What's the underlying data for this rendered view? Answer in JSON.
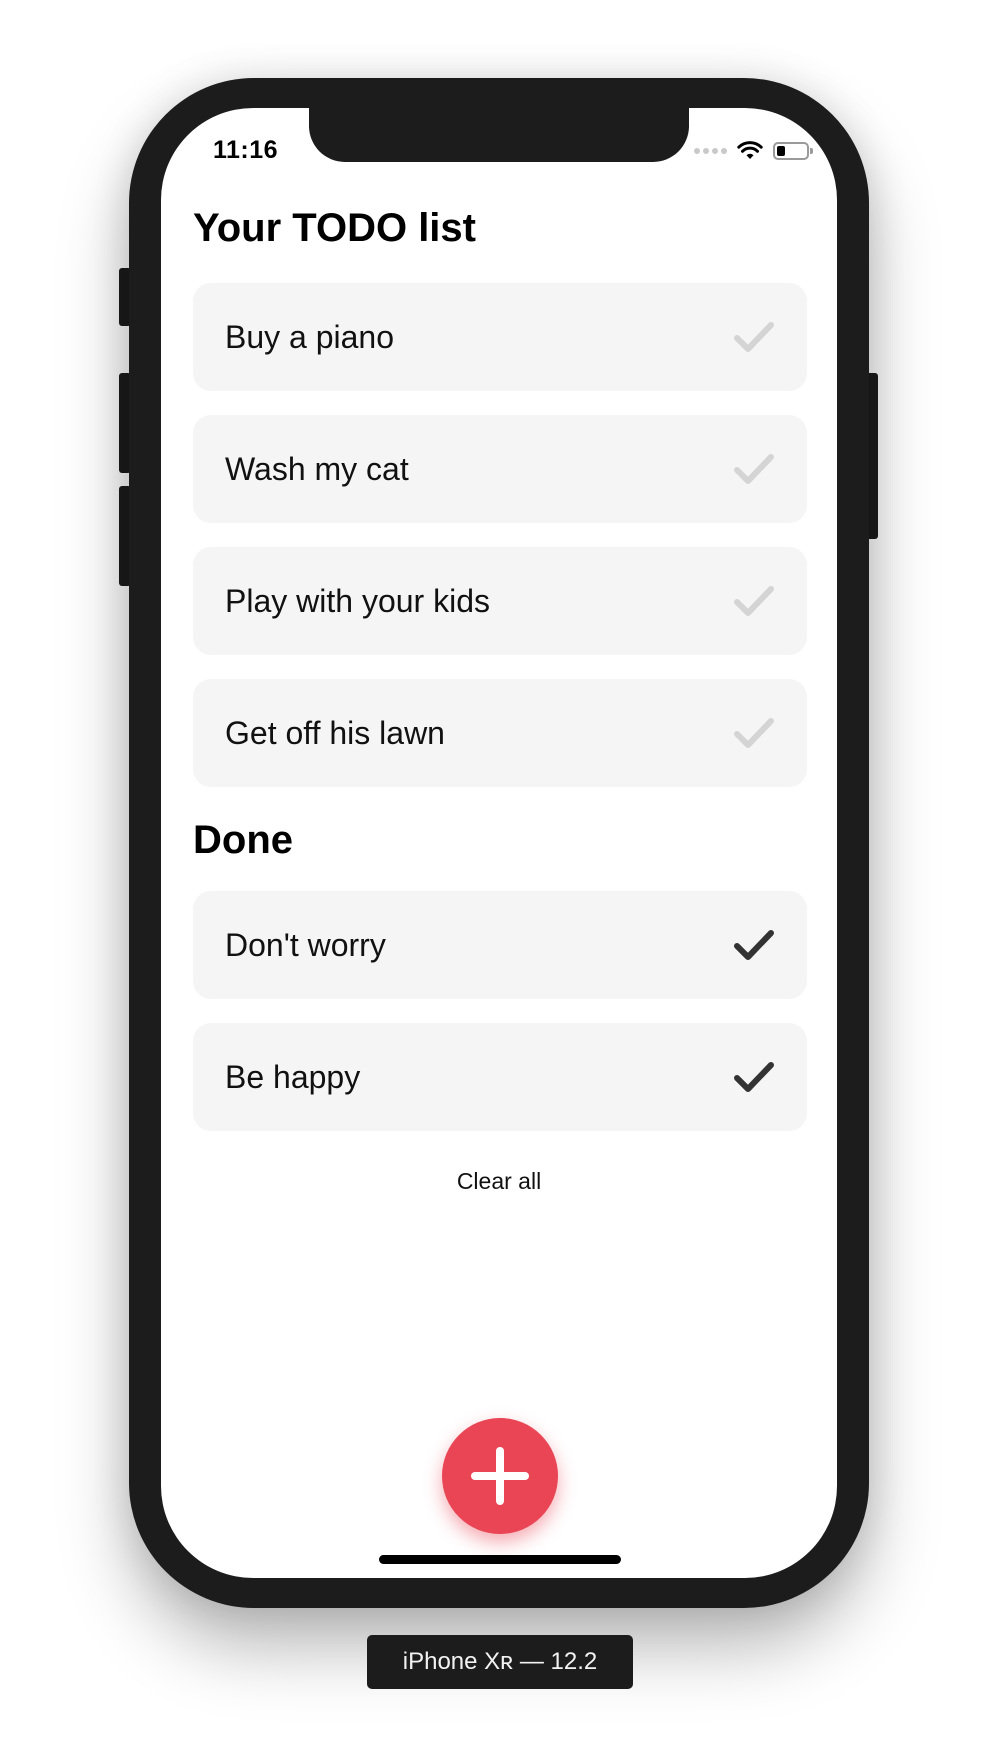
{
  "status_bar": {
    "time": "11:16",
    "battery_level": 0.3
  },
  "todo": {
    "title": "Your TODO list",
    "items": [
      {
        "label": "Buy a piano",
        "done": false
      },
      {
        "label": "Wash my cat",
        "done": false
      },
      {
        "label": "Play with your kids",
        "done": false
      },
      {
        "label": "Get off his lawn",
        "done": false
      }
    ]
  },
  "done": {
    "title": "Done",
    "items": [
      {
        "label": "Don't worry",
        "done": true
      },
      {
        "label": "Be happy",
        "done": true
      }
    ]
  },
  "actions": {
    "clear_all_label": "Clear all",
    "add_icon": "plus-icon"
  },
  "device_label": "iPhone Xʀ — 12.2",
  "colors": {
    "fab": "#e94555",
    "item_background": "#f5f5f5",
    "check_inactive": "#d4d4d4",
    "check_active": "#333333"
  }
}
